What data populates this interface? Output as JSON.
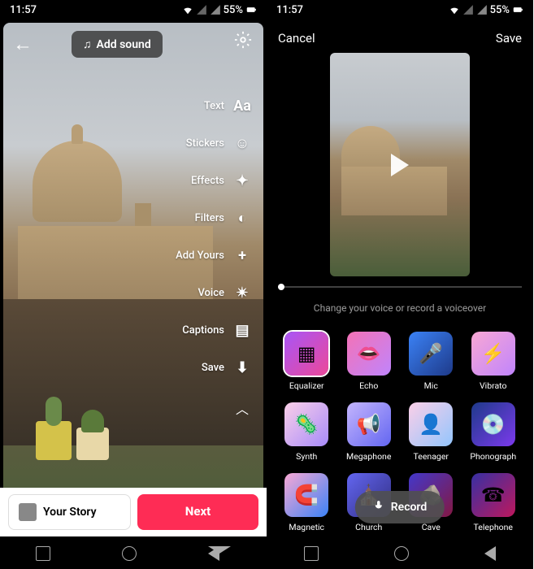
{
  "status": {
    "time": "11:57",
    "battery": "55%"
  },
  "left": {
    "add_sound_label": "Add sound",
    "tools": [
      {
        "label": "Text",
        "icon": "Aa"
      },
      {
        "label": "Stickers",
        "icon": "☺"
      },
      {
        "label": "Effects",
        "icon": "✦"
      },
      {
        "label": "Filters",
        "icon": "◐"
      },
      {
        "label": "Add Yours",
        "icon": "+"
      },
      {
        "label": "Voice",
        "icon": "✴"
      },
      {
        "label": "Captions",
        "icon": "▤"
      },
      {
        "label": "Save",
        "icon": "⬇"
      }
    ],
    "your_story": "Your Story",
    "next": "Next"
  },
  "right": {
    "cancel": "Cancel",
    "save": "Save",
    "hint": "Change your voice or record a voiceover",
    "record": "Record",
    "voices": [
      {
        "name": "Equalizer",
        "css": "t-equalizer",
        "glyph": "▦",
        "selected": true
      },
      {
        "name": "Echo",
        "css": "t-echo",
        "glyph": "👄",
        "selected": false
      },
      {
        "name": "Mic",
        "css": "t-mic",
        "glyph": "🎤",
        "selected": false
      },
      {
        "name": "Vibrato",
        "css": "t-vibrato",
        "glyph": "⚡",
        "selected": false
      },
      {
        "name": "Synth",
        "css": "t-synth",
        "glyph": "🦠",
        "selected": false
      },
      {
        "name": "Megaphone",
        "css": "t-megaphone",
        "glyph": "📢",
        "selected": false
      },
      {
        "name": "Teenager",
        "css": "t-teenager",
        "glyph": "👤",
        "selected": false
      },
      {
        "name": "Phonograph",
        "css": "t-phonograph",
        "glyph": "💿",
        "selected": false
      },
      {
        "name": "Magnetic",
        "css": "t-magnetic",
        "glyph": "🧲",
        "selected": false
      },
      {
        "name": "Church",
        "css": "t-church",
        "glyph": "⛪",
        "selected": false
      },
      {
        "name": "Cave",
        "css": "t-cave",
        "glyph": "🪨",
        "selected": false
      },
      {
        "name": "Telephone",
        "css": "t-telephone",
        "glyph": "☎",
        "selected": false
      }
    ]
  }
}
